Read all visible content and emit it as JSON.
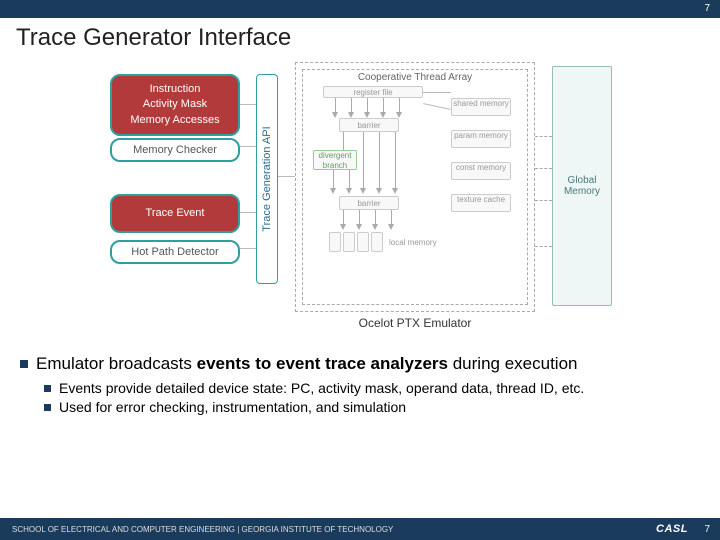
{
  "page_number_top": "7",
  "title": "Trace Generator Interface",
  "left_panel": {
    "instruction_box": "Instruction\nActivity Mask\nMemory Accesses",
    "memory_checker": "Memory Checker",
    "trace_event": "Trace Event",
    "hot_path_detector": "Hot Path Detector",
    "api_label": "Trace Generation API"
  },
  "emulator": {
    "frame_label": "Ocelot PTX Emulator",
    "cta_label": "Cooperative Thread Array",
    "register_file": "register file",
    "barrier": "barrier",
    "divergent_branch": "divergent branch",
    "shared_memory": "shared memory",
    "param_memory": "param memory",
    "const_memory": "const memory",
    "texture_cache": "texture cache",
    "local_memory": "local memory",
    "global_memory": "Global\nMemory"
  },
  "bullets": {
    "main_pre": "Emulator broadcasts ",
    "main_bold": "events to event trace analyzers",
    "main_post": " during execution",
    "sub1": "Events provide detailed device state: PC, activity mask, operand data, thread ID, etc.",
    "sub2": "Used for error checking, instrumentation, and simulation"
  },
  "footer": {
    "text": "SCHOOL OF ELECTRICAL AND COMPUTER ENGINEERING | GEORGIA INSTITUTE OF TECHNOLOGY",
    "logo": "CASL",
    "page": "7"
  }
}
